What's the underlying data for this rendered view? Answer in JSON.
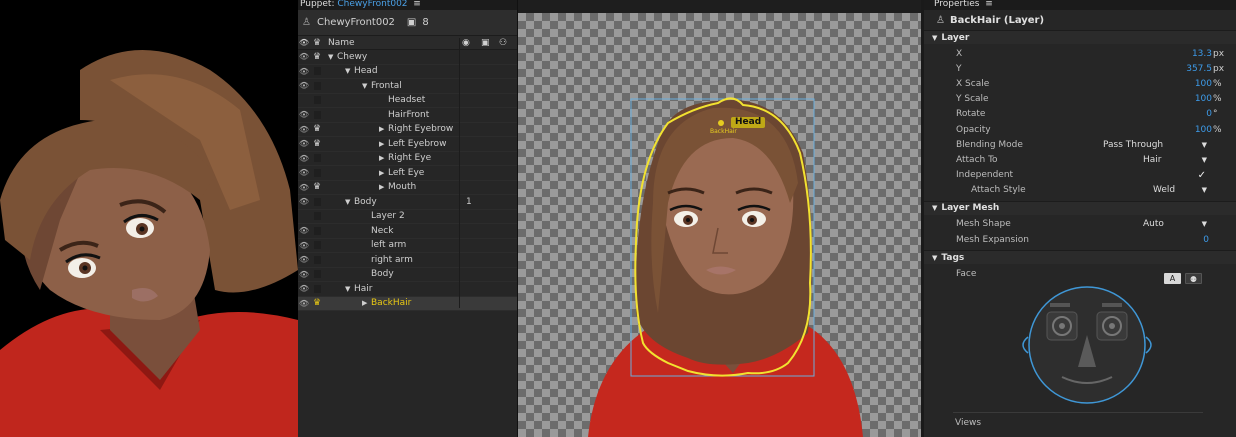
{
  "puppet_panel": {
    "header_label": "Puppet:",
    "header_value": "ChewyFront002",
    "puppet_name": "ChewyFront002",
    "count": "8",
    "col_name": "Name",
    "rows": [
      {
        "name": "Chewy",
        "level": 0,
        "twirl": "down",
        "crown": true,
        "eye": true
      },
      {
        "name": "Head",
        "level": 1,
        "twirl": "down",
        "crown": false,
        "eye": true
      },
      {
        "name": "Frontal",
        "level": 2,
        "twirl": "down",
        "crown": false,
        "eye": true
      },
      {
        "name": "Headset",
        "level": 3,
        "twirl": "",
        "crown": false,
        "eye": false
      },
      {
        "name": "HairFront",
        "level": 3,
        "twirl": "",
        "crown": false,
        "eye": true
      },
      {
        "name": "Right Eyebrow",
        "level": 3,
        "twirl": "right",
        "crown": true,
        "eye": true
      },
      {
        "name": "Left Eyebrow",
        "level": 3,
        "twirl": "right",
        "crown": true,
        "eye": true
      },
      {
        "name": "Right Eye",
        "level": 3,
        "twirl": "right",
        "crown": false,
        "eye": true
      },
      {
        "name": "Left Eye",
        "level": 3,
        "twirl": "right",
        "crown": false,
        "eye": true
      },
      {
        "name": "Mouth",
        "level": 3,
        "twirl": "right",
        "crown": true,
        "eye": true
      },
      {
        "name": "Body",
        "level": 1,
        "twirl": "down",
        "crown": false,
        "eye": true,
        "value": "1"
      },
      {
        "name": "Layer 2",
        "level": 2,
        "twirl": "",
        "crown": false,
        "eye": false
      },
      {
        "name": "Neck",
        "level": 2,
        "twirl": "",
        "crown": false,
        "eye": true
      },
      {
        "name": "left arm",
        "level": 2,
        "twirl": "",
        "crown": false,
        "eye": true
      },
      {
        "name": "right arm",
        "level": 2,
        "twirl": "",
        "crown": false,
        "eye": true
      },
      {
        "name": "Body",
        "level": 2,
        "twirl": "",
        "crown": false,
        "eye": true
      },
      {
        "name": "Hair",
        "level": 1,
        "twirl": "down",
        "crown": false,
        "eye": true
      },
      {
        "name": "BackHair",
        "level": 2,
        "twirl": "right",
        "crown": true,
        "eye": true,
        "selected": true
      }
    ]
  },
  "canvas": {
    "handle_tag": "Head",
    "layer_tag": "BackHair"
  },
  "properties": {
    "header": "Properties",
    "title": "BackHair (Layer)",
    "sections": {
      "layer": "Layer",
      "mesh": "Layer Mesh",
      "tags": "Tags"
    },
    "layer": {
      "x_label": "X",
      "x_value": "13.3",
      "x_unit": "px",
      "y_label": "Y",
      "y_value": "357.5",
      "y_unit": "px",
      "xscale_label": "X Scale",
      "xscale_value": "100",
      "xscale_unit": "%",
      "yscale_label": "Y Scale",
      "yscale_value": "100",
      "yscale_unit": "%",
      "rotate_label": "Rotate",
      "rotate_value": "0",
      "rotate_unit": "°",
      "opacity_label": "Opacity",
      "opacity_value": "100",
      "opacity_unit": "%",
      "blend_label": "Blending Mode",
      "blend_value": "Pass Through",
      "attach_label": "Attach To",
      "attach_value": "Hair",
      "indep_label": "Independent",
      "indep_check": "✓",
      "style_label": "Attach Style",
      "style_value": "Weld"
    },
    "mesh": {
      "shape_label": "Mesh Shape",
      "shape_value": "Auto",
      "exp_label": "Mesh Expansion",
      "exp_value": "0"
    },
    "tags": {
      "face_label": "Face",
      "btn_a": "A",
      "views_label": "Views"
    }
  },
  "colors": {
    "accent_blue": "#3d9be9",
    "selection_yellow": "#e8c814",
    "outline_yellow": "#f2e230",
    "bbox_blue": "#6aaedc"
  }
}
